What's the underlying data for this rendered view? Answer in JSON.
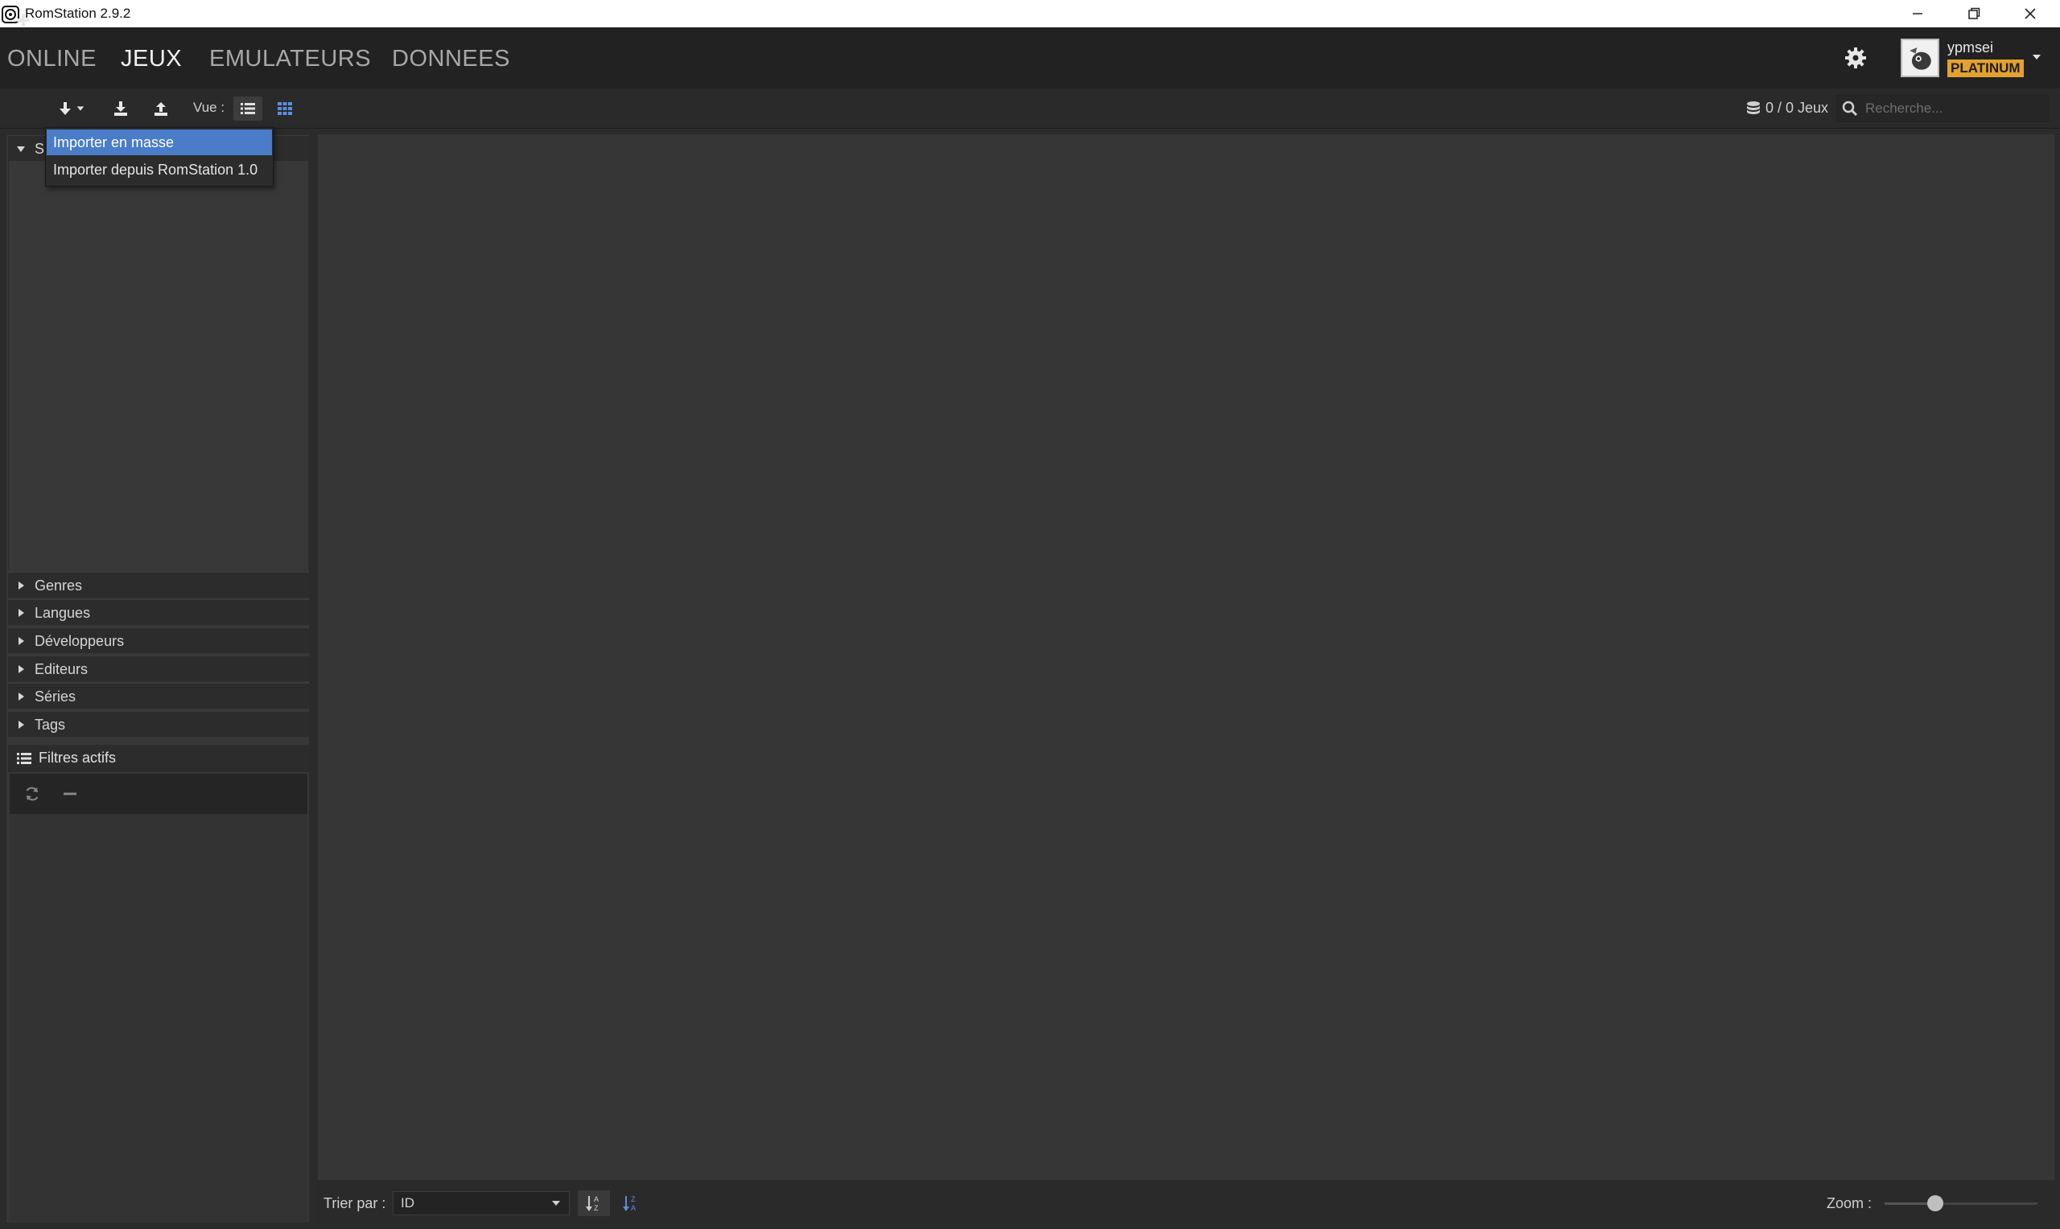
{
  "window": {
    "title": "RomStation 2.9.2",
    "controls": [
      "minimize-icon",
      "restore-icon",
      "close-icon"
    ]
  },
  "nav": {
    "tabs": [
      {
        "label": "ONLINE",
        "active": false
      },
      {
        "label": "JEUX",
        "active": true
      },
      {
        "label": "EMULATEURS",
        "active": false
      },
      {
        "label": "DONNEES",
        "active": false
      }
    ]
  },
  "user": {
    "name": "ypmsei",
    "badge": "PLATINUM",
    "badge_color": "#e2a22f"
  },
  "toolbar": {
    "view_label": "Vue :",
    "games_count": "0 / 0 Jeux",
    "search_placeholder": "Recherche..."
  },
  "import_menu": {
    "items": [
      {
        "label": "Importer en masse",
        "selected": true
      },
      {
        "label": "Importer depuis RomStation 1.0",
        "selected": false
      }
    ]
  },
  "sidebar": {
    "systems_label": "S",
    "sections": [
      "Genres",
      "Langues",
      "Développeurs",
      "Editeurs",
      "Séries",
      "Tags"
    ],
    "filters_label": "Filtres actifs"
  },
  "bottom": {
    "sort_label": "Trier par :",
    "sort_value": "ID",
    "zoom_label": "Zoom :",
    "zoom_level": 0.33
  },
  "colors": {
    "accent": "#4a7cc8",
    "background": "#2b2b2b",
    "nav_background": "#222222"
  }
}
